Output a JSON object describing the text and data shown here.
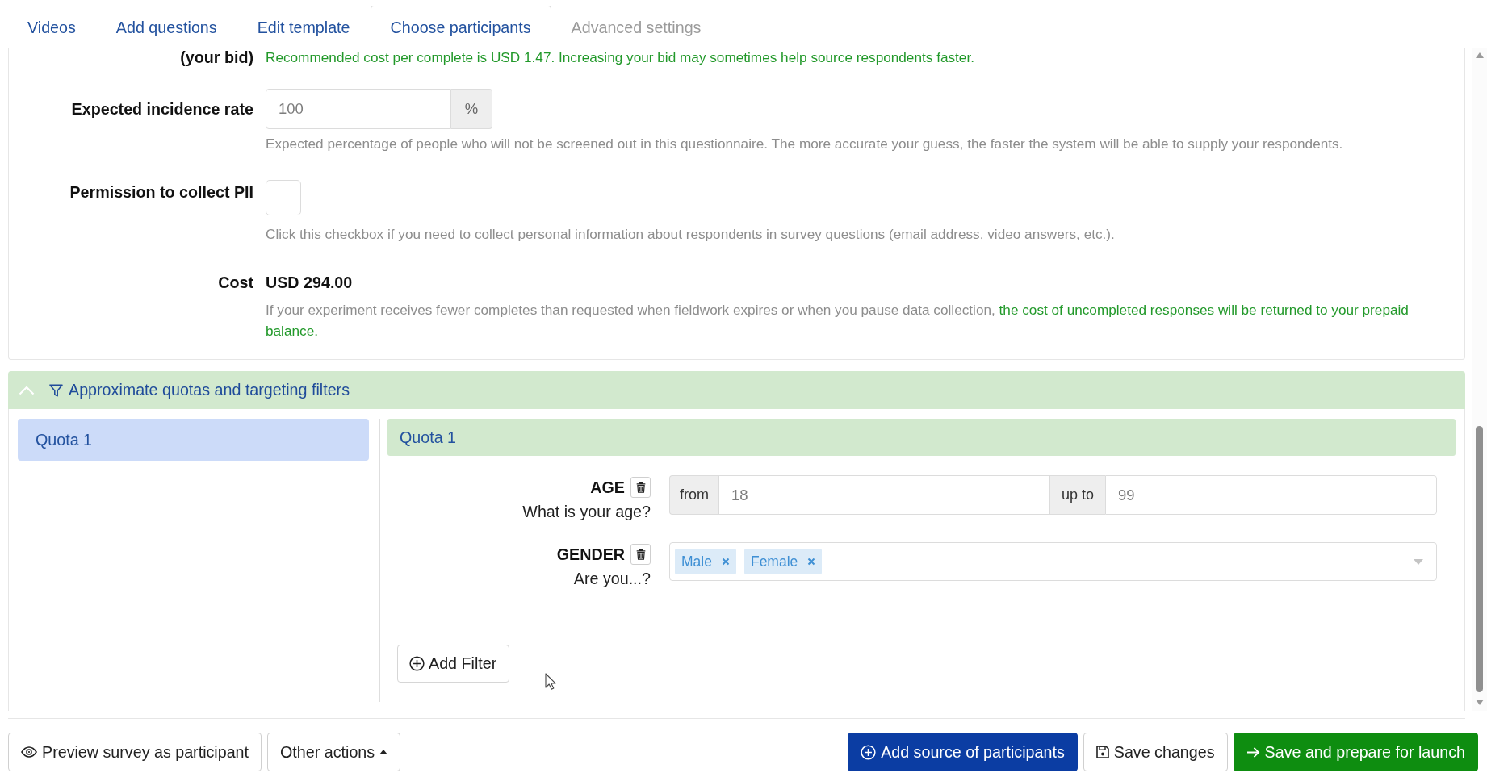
{
  "tabs": [
    {
      "label": "Videos",
      "selected": false,
      "disabled": false
    },
    {
      "label": "Add questions",
      "selected": false,
      "disabled": false
    },
    {
      "label": "Edit template",
      "selected": false,
      "disabled": false
    },
    {
      "label": "Choose participants",
      "selected": true,
      "disabled": false
    },
    {
      "label": "Advanced settings",
      "selected": false,
      "disabled": true
    }
  ],
  "settings": {
    "bid": {
      "label": "(your bid)",
      "hint": "Recommended cost per complete is USD 1.47. Increasing your bid may sometimes help source respondents faster."
    },
    "incidence": {
      "label": "Expected incidence rate",
      "value": "100",
      "unit": "%",
      "help": "Expected percentage of people who will not be screened out in this questionnaire. The more accurate your guess, the faster the system will be able to supply your respondents."
    },
    "pii": {
      "label": "Permission to collect PII",
      "checked": false,
      "help": "Click this checkbox if you need to collect personal information about respondents in survey questions (email address, video answers, etc.)."
    },
    "cost": {
      "label": "Cost",
      "value": "USD 294.00",
      "help": "If your experiment receives fewer completes than requested when fieldwork expires or when you pause data collection,",
      "help_highlight": "the cost of uncompleted responses will be returned to your prepaid balance."
    }
  },
  "quotas_panel": {
    "title": "Approximate quotas and targeting filters",
    "expanded": true,
    "quotas": [
      {
        "label": "Quota 1",
        "selected": true
      }
    ],
    "active_quota": {
      "title": "Quota 1",
      "filters": [
        {
          "kind": "range",
          "name": "AGE",
          "question": "What is your age?",
          "from_label": "from",
          "from_value": "18",
          "to_label": "up to",
          "to_value": "99"
        },
        {
          "kind": "choice",
          "name": "GENDER",
          "question": "Are you...?",
          "tags": [
            "Male",
            "Female"
          ]
        }
      ],
      "add_filter": "Add Filter"
    }
  },
  "footer": {
    "left_buttons": [
      {
        "kind": "preview",
        "label": "Preview survey as participant"
      },
      {
        "kind": "menu",
        "label": "Other actions"
      }
    ],
    "right_buttons": [
      {
        "kind": "add",
        "label": "Add source of participants"
      },
      {
        "kind": "save",
        "label": "Save changes"
      },
      {
        "kind": "launch",
        "label": "Save and prepare for launch"
      }
    ]
  }
}
